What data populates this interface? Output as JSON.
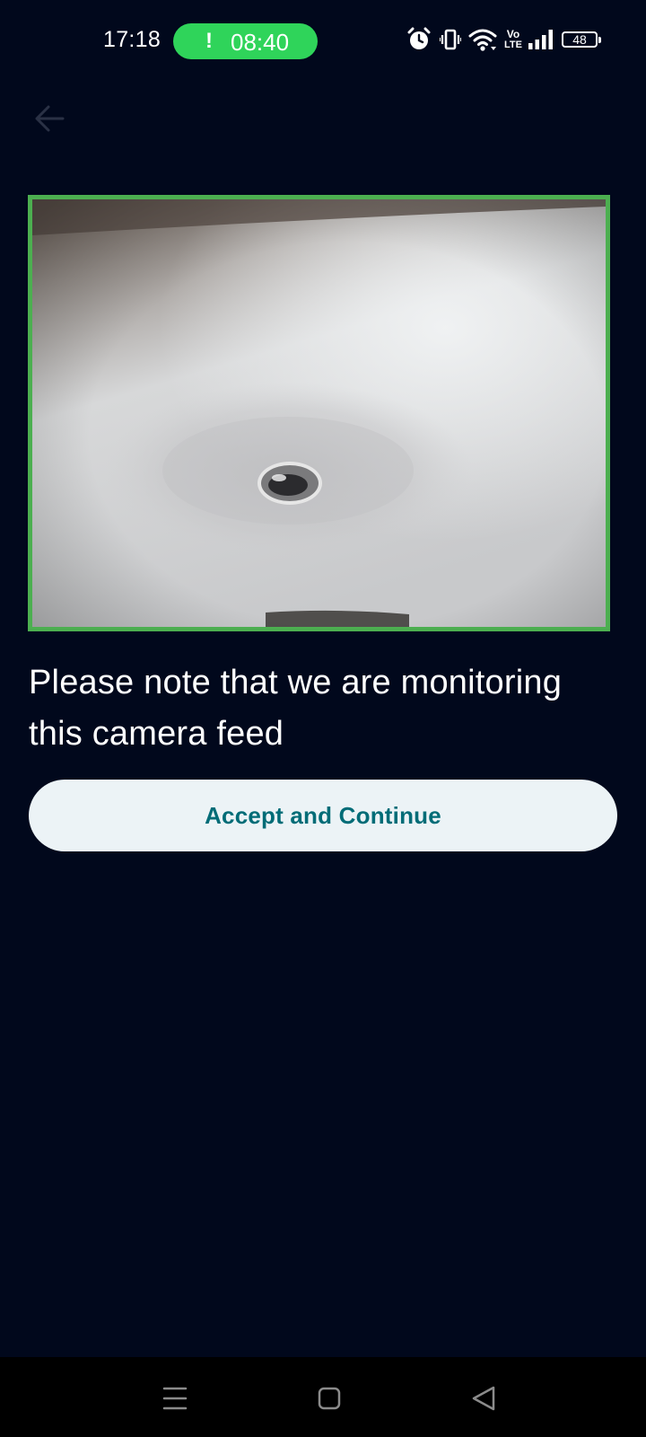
{
  "status_bar": {
    "time": "17:18",
    "call_indicator": "!",
    "call_duration": "08:40",
    "battery_level": "48",
    "network_label_top": "Vo",
    "network_label_bottom": "LTE",
    "icons": [
      "alarm-icon",
      "vibrate-icon",
      "wifi-icon",
      "volte-icon",
      "signal-icon",
      "battery-icon"
    ]
  },
  "header": {
    "back_icon": "arrow-left-icon"
  },
  "camera": {
    "border_color": "#4caf50"
  },
  "notice": {
    "text": "Please note that we are monitoring this camera feed"
  },
  "actions": {
    "accept_label": "Accept and Continue"
  },
  "nav_bar": {
    "icons": [
      "menu-icon",
      "home-icon",
      "back-triangle-icon"
    ]
  },
  "colors": {
    "background": "#01081c",
    "accent_green": "#4caf50",
    "call_pill": "#2fd45a",
    "button_bg": "#ecf3f6",
    "button_text": "#006c77"
  }
}
